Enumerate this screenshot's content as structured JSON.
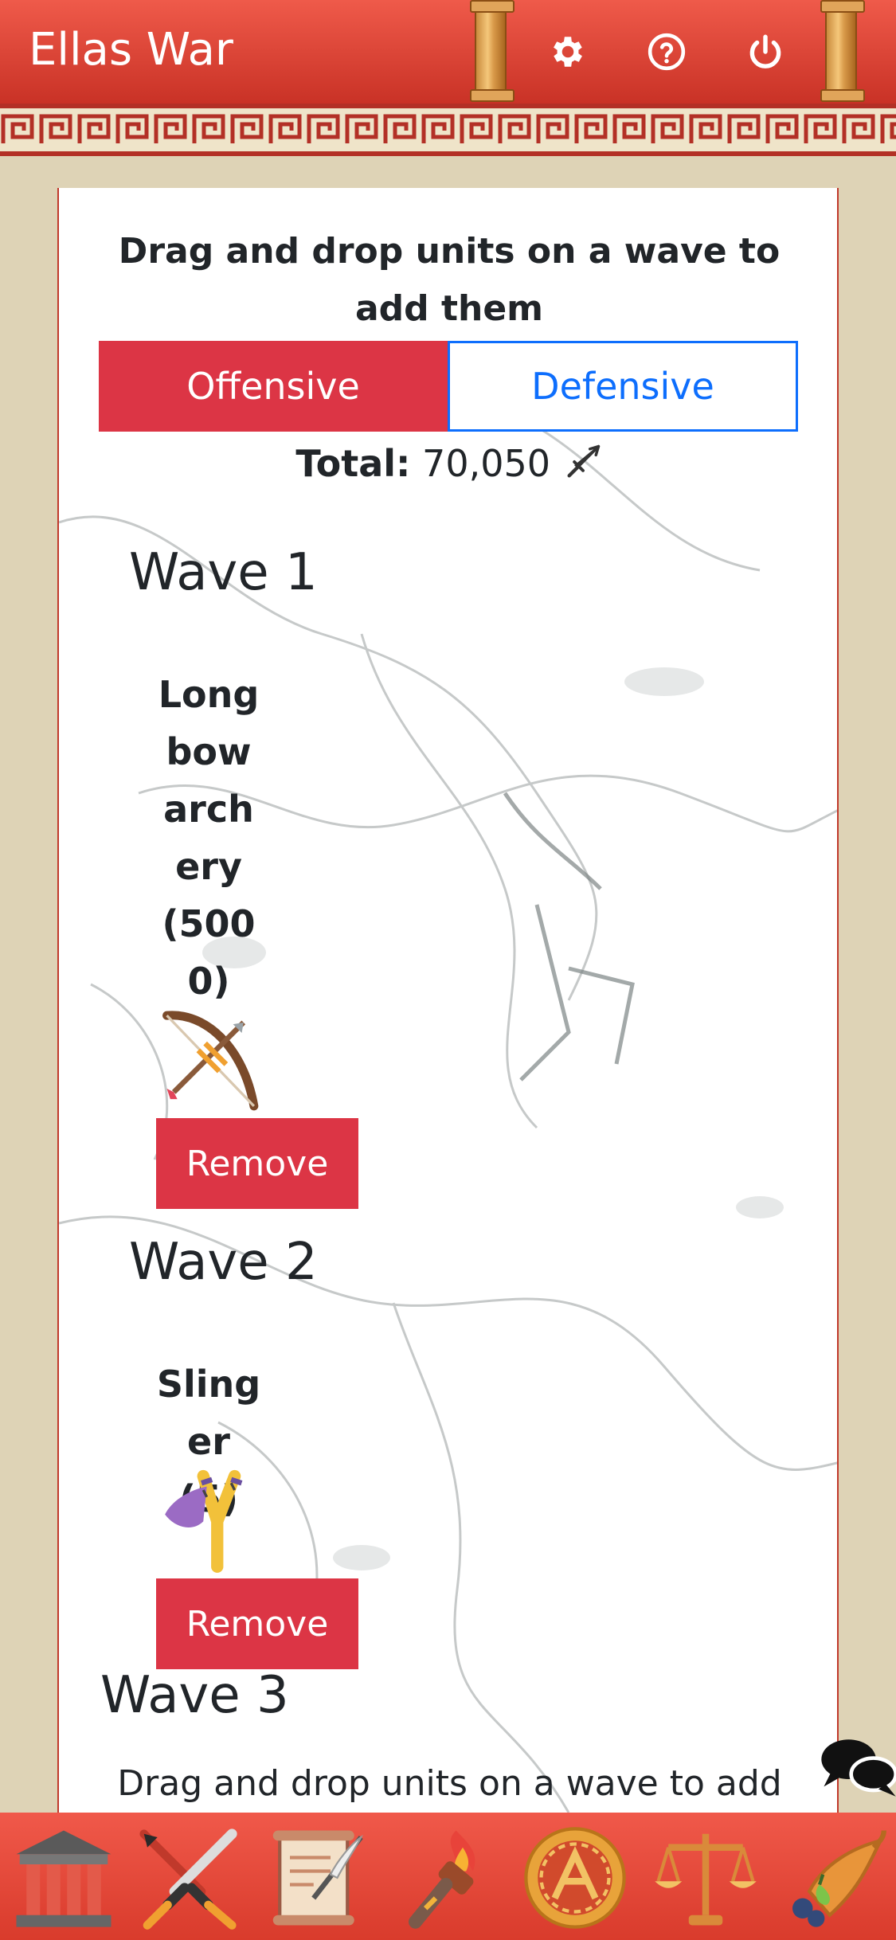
{
  "header": {
    "title": "Ellas War",
    "icons": [
      "gear-icon",
      "help-circle-icon",
      "power-icon"
    ]
  },
  "main": {
    "instruction": "Drag and drop units on a wave to add them",
    "tabs": [
      {
        "label": "Offensive",
        "active": true
      },
      {
        "label": "Defensive",
        "active": false
      }
    ],
    "total": {
      "label": "Total:",
      "value": "70,050",
      "icon": "sword-icon"
    },
    "waves": [
      {
        "title": "Wave 1",
        "unit": {
          "name": "Longbow archery",
          "count": "(5000)",
          "icon": "bow-arrow-icon"
        },
        "remove_label": "Remove"
      },
      {
        "title": "Wave 2",
        "unit": {
          "name": "Slinger",
          "count": "(5)",
          "icon": "slingshot-icon"
        },
        "remove_label": "Remove"
      },
      {
        "title": "Wave 3",
        "instruction": "Drag and drop units on a wave to add"
      }
    ]
  },
  "bottom_nav": {
    "items": [
      "temple-icon",
      "crossed-swords-icon",
      "scroll-quill-icon",
      "torch-icon",
      "spartan-shield-icon",
      "scales-icon",
      "cornucopia-icon"
    ]
  },
  "colors": {
    "header_red": "#e24a3b",
    "danger": "#dc3545",
    "primary": "#0d6efd",
    "parchment": "#ded3b6"
  }
}
